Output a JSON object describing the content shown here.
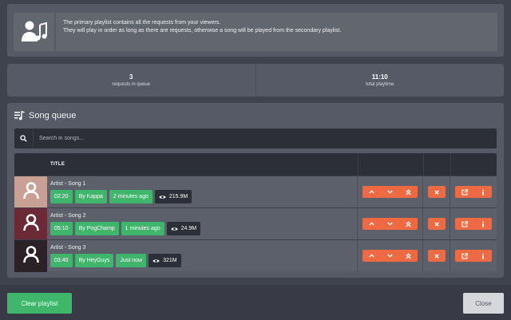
{
  "info": {
    "line1": "The primary playlist contains all the requests from your viewers.",
    "line2": "They will play in order as long as there are requests, otherwise a song will be played from the secondary playlist.",
    "icon": "user-music-icon"
  },
  "stats": {
    "requests_value": "3",
    "requests_label": "requests in queue",
    "playtime_value": "11:10",
    "playtime_label": "total playtime"
  },
  "queue": {
    "title": "Song queue",
    "search_placeholder": "Search in songs...",
    "column_title": "TITLE",
    "songs": [
      {
        "name": "Artist - Song 1",
        "duration": "02:20",
        "requester": "By Kappa",
        "added": "2 minutes ago",
        "views": "215.9M",
        "thumb_color": "#c8a194"
      },
      {
        "name": "Artist - Song 2",
        "duration": "05:10",
        "requester": "By PogChamp",
        "added": "1 minutes ago",
        "views": "24.9M",
        "thumb_color": "#6b2a35"
      },
      {
        "name": "Artist - Song 3",
        "duration": "03:40",
        "requester": "By HeyGuys",
        "added": "Just now",
        "views": "321M",
        "thumb_color": "#2a2227"
      }
    ]
  },
  "footer": {
    "clear_label": "Clear playlist",
    "close_label": "Close"
  },
  "colors": {
    "accent_orange": "#ee6a43",
    "accent_green": "#3fb66b",
    "background": "#3f434e",
    "card": "#555a66"
  }
}
